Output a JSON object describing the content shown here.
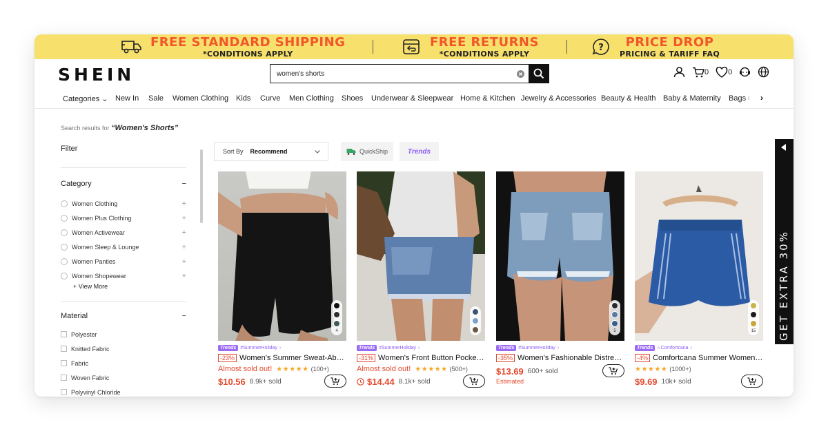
{
  "promo": {
    "items": [
      {
        "title": "FREE STANDARD SHIPPING",
        "sub": "*CONDITIONS APPLY",
        "icon": "truck-icon"
      },
      {
        "title": "FREE RETURNS",
        "sub": "*CONDITIONS APPLY",
        "icon": "return-box-icon"
      },
      {
        "title": "PRICE DROP",
        "sub": "PRICING & TARIFF FAQ",
        "icon": "question-chat-icon"
      }
    ],
    "colors": {
      "background": "#f7e06c",
      "title": "#f2562b"
    }
  },
  "header": {
    "logo": "SHEIN",
    "search_value": "women's shorts",
    "cart_count": "0",
    "wishlist_count": "0"
  },
  "nav": {
    "items": [
      "Categories",
      "New In",
      "Sale",
      "Women Clothing",
      "Kids",
      "Curve",
      "Men Clothing",
      "Shoes",
      "Underwear & Sleepwear",
      "Home & Kitchen",
      "Jewelry & Accessories",
      "Beauty & Health",
      "Baby & Maternity",
      "Bags"
    ]
  },
  "results": {
    "prefix": "Search results for",
    "query": "“Women's Shorts”"
  },
  "filter": {
    "title": "Filter",
    "category": {
      "title": "Category",
      "toggle": "−",
      "items": [
        "Women Clothing",
        "Women Plus Clothing",
        "Women Activewear",
        "Women Sleep & Lounge",
        "Women Panties",
        "Women Shopewear"
      ],
      "view_more": "+ View More"
    },
    "material": {
      "title": "Material",
      "toggle": "−",
      "items": [
        "Polyester",
        "Knitted Fabric",
        "Fabric",
        "Woven Fabric",
        "Polyvinyl Chloride"
      ]
    }
  },
  "toolbar": {
    "sort_label": "Sort By",
    "sort_value": "Recommend",
    "quickship": "QuickShip",
    "trends": "Trends"
  },
  "products": [
    {
      "tag": "Trends",
      "hashtag": "#SummerHoliday",
      "discount": "-23%",
      "name": "Women's Summer Sweat-Absorbent...",
      "status": "Almost sold out!",
      "stars": "★★★★★",
      "reviews": "(100+)",
      "price": "$10.56",
      "sold": "8.9k+ sold",
      "swatch_count": "4"
    },
    {
      "tag": "Trends",
      "hashtag": "#SummerHoliday",
      "discount": "-31%",
      "name": "Women's Front Button Pocket Ripped...",
      "status": "Almost sold out!",
      "stars": "★★★★★",
      "reviews": "(500+)",
      "price": "$14.44",
      "sold": "8.1k+ sold",
      "swatch_count": ""
    },
    {
      "tag": "Trends",
      "hashtag": "#SummerHoliday",
      "discount": "-35%",
      "name": "Women's Fashionable Distressed...",
      "price": "$13.69",
      "sold": "600+ sold",
      "estimated": "Estimated",
      "swatch_count": "5"
    },
    {
      "tag": "Trends",
      "hashtag": "Comfortcana",
      "discount": "-4%",
      "name": "Comfortcana Summer Women ...",
      "stars": "★★★★★",
      "reviews": "(1000+)",
      "price": "$9.69",
      "sold": "10k+ sold",
      "swatch_count": "15"
    }
  ],
  "side_tab": {
    "label": "GET EXTRA 30%"
  }
}
